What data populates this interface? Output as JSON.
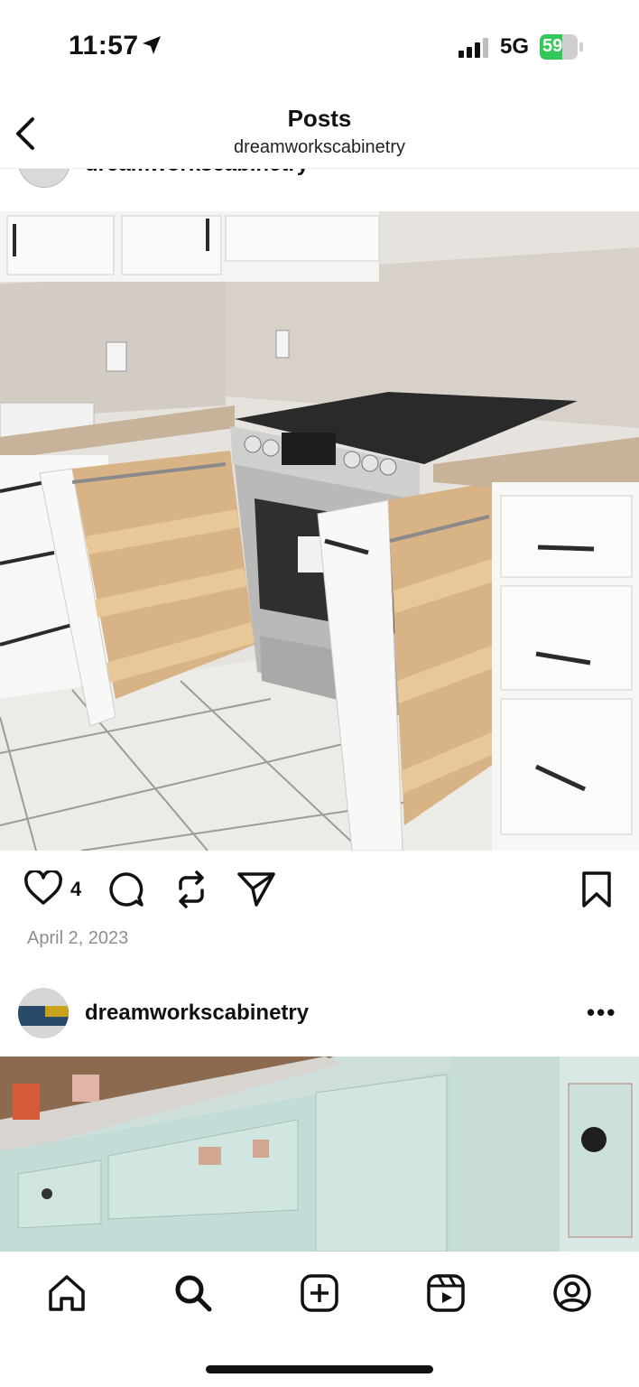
{
  "status_bar": {
    "time": "11:57",
    "network": "5G",
    "battery": "59",
    "battery_level": 0.59
  },
  "header": {
    "title": "Posts",
    "subtitle": "dreamworkscabinetry"
  },
  "post1": {
    "username": "dreamworkscabinetry",
    "likes": "4",
    "date": "April 2, 2023"
  },
  "post2": {
    "username": "dreamworkscabinetry",
    "more": "•••"
  },
  "icons": [
    "location-arrow-icon",
    "signal-icon",
    "battery-icon",
    "back-chevron-icon",
    "heart-icon",
    "comment-icon",
    "repost-icon",
    "share-icon",
    "bookmark-icon",
    "more-icon",
    "home-icon",
    "search-icon",
    "create-icon",
    "reels-icon",
    "profile-icon"
  ],
  "colors": {
    "battery_fill": "#34c759",
    "date_text": "#8e8e8e"
  }
}
